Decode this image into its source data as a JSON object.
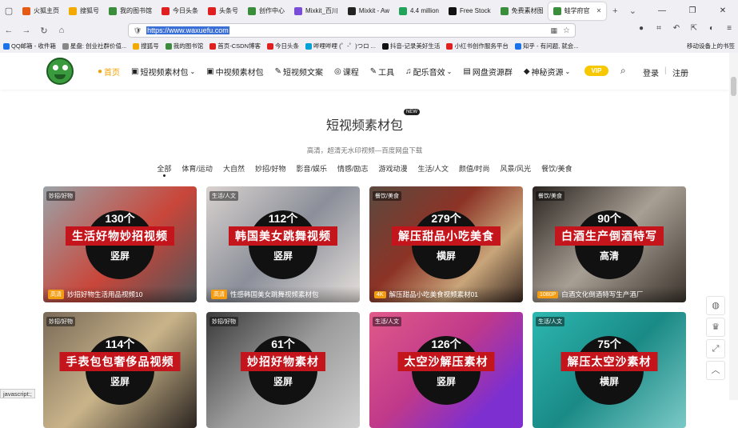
{
  "tabs": [
    {
      "label": "火狐主页",
      "color": "#e55b13"
    },
    {
      "label": "搜狐号",
      "color": "#f2a900"
    },
    {
      "label": "我的图书馆",
      "color": "#3a8d3a"
    },
    {
      "label": "今日头条",
      "color": "#e02020"
    },
    {
      "label": "头条号",
      "color": "#e02020"
    },
    {
      "label": "创作中心",
      "color": "#3a8d3a"
    },
    {
      "label": "Mixkit_百川",
      "color": "#7a4dd8"
    },
    {
      "label": "Mixkit - Aw",
      "color": "#222222"
    },
    {
      "label": "4.4 million",
      "color": "#22a35a"
    },
    {
      "label": "Free Stock",
      "color": "#111111"
    },
    {
      "label": "免费素材图",
      "color": "#3a8d3a"
    },
    {
      "label": "蛙学府官",
      "color": "#3a8d3a",
      "active": true
    }
  ],
  "url": {
    "value": "https://www.waxuefu.com"
  },
  "bookmarks": [
    {
      "label": "QQ邮箱 - 收件箱",
      "color": "#1a73e8"
    },
    {
      "label": "星盘: 创业社群价值...",
      "color": "#888888"
    },
    {
      "label": "搜狐号",
      "color": "#f2a900"
    },
    {
      "label": "我的图书馆",
      "color": "#3a8d3a"
    },
    {
      "label": "首页-CSDN博客",
      "color": "#e02020"
    },
    {
      "label": "今日头条",
      "color": "#e02020"
    },
    {
      "label": "哔哩哔哩 (゜-゜)つロ ...",
      "color": "#00a1d6"
    },
    {
      "label": "抖音-记录美好生活",
      "color": "#111111"
    },
    {
      "label": "小红书创作服务平台",
      "color": "#e02020"
    },
    {
      "label": "知乎 - 有问题, 就会...",
      "color": "#1a73e8"
    }
  ],
  "bookmarks_right": "移动设备上的书签",
  "nav": [
    {
      "label": "首页",
      "active": true
    },
    {
      "label": "短视频素材包",
      "dropdown": true
    },
    {
      "label": "中视频素材包"
    },
    {
      "label": "短视频文案"
    },
    {
      "label": "课程"
    },
    {
      "label": "工具"
    },
    {
      "label": "配乐音效",
      "dropdown": true
    },
    {
      "label": "网盘资源群"
    },
    {
      "label": "神秘资源",
      "dropdown": true
    }
  ],
  "vip": "VIP",
  "login": "登录",
  "sep": "|",
  "register": "注册",
  "section": {
    "title": "短视频素材包",
    "badge": "NEW",
    "subtitle": "高清，超清无水印视频—百度网盘下载"
  },
  "categories": [
    "全部",
    "体育/运动",
    "大自然",
    "妙招/好物",
    "影音/娱乐",
    "情感/励志",
    "游戏动漫",
    "生活/人文",
    "颜值/时尚",
    "风景/风光",
    "餐饮/美食"
  ],
  "cards": [
    {
      "tag": "妙招/好物",
      "count": "130个",
      "title": "生活好物妙招视频",
      "orient": "竖屏",
      "quality": "高清",
      "caption": "妙招好物生活用品视频10",
      "bg": "linear-gradient(135deg,#9aa3a8,#c9463a 55%,#4d5559)"
    },
    {
      "tag": "生活/人文",
      "count": "112个",
      "title": "韩国美女跳舞视频",
      "orient": "竖屏",
      "quality": "高清",
      "caption": "性感韩国美女跳舞视频素材包",
      "bg": "linear-gradient(135deg,#d9d2cf,#8b8f99 50%,#e6e0dc)"
    },
    {
      "tag": "餐饮/美食",
      "count": "279个",
      "title": "解压甜品小吃美食",
      "orient": "横屏",
      "quality": "4K",
      "caption": "解压甜品小吃美食视频素材01",
      "bg": "linear-gradient(135deg,#5b4a40,#8c3326 40%,#c9a57a 70%,#3a2a22)"
    },
    {
      "tag": "餐饮/美食",
      "count": "90个",
      "title": "白酒生产倒酒特写",
      "orient": "高清",
      "quality": "1080P",
      "caption": "白酒文化倒酒特写生产酒厂",
      "bg": "linear-gradient(135deg,#2a2420,#a89f94 50%,#3b332c)"
    },
    {
      "tag": "妙招/好物",
      "count": "114个",
      "title": "手表包包奢侈品视频",
      "orient": "竖屏",
      "quality": "",
      "caption": "",
      "bg": "linear-gradient(135deg,#7a6a58,#c9b48a 50%,#2b2420)"
    },
    {
      "tag": "妙招/好物",
      "count": "61个",
      "title": "妙招好物素材",
      "orient": "竖屏",
      "quality": "",
      "caption": "",
      "bg": "linear-gradient(135deg,#3a3a3a,#9c9c9c 50%,#d0d0d0)"
    },
    {
      "tag": "生活/人文",
      "count": "126个",
      "title": "太空沙解压素材",
      "orient": "竖屏",
      "quality": "",
      "caption": "",
      "bg": "linear-gradient(135deg,#e05a8a,#c0398a 45%,#7d2fd0 80%)"
    },
    {
      "tag": "生活/人文",
      "count": "75个",
      "title": "解压太空沙素材",
      "orient": "横屏",
      "quality": "",
      "caption": "",
      "bg": "linear-gradient(135deg,#2db7b0,#1a8a86 50%,#7bc9c6)"
    }
  ],
  "status": "javascript:;"
}
